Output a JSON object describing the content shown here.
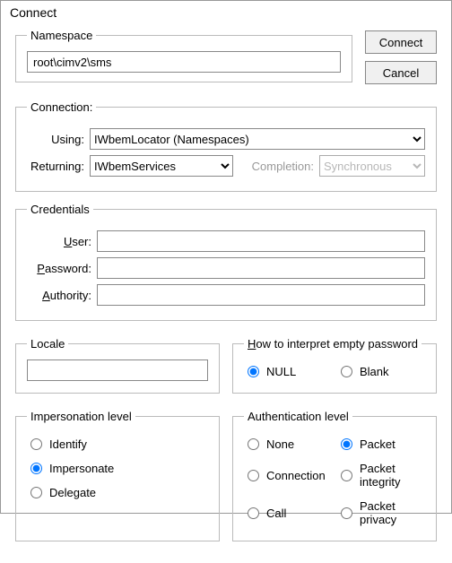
{
  "title": "Connect",
  "buttons": {
    "connect": "Connect",
    "cancel": "Cancel"
  },
  "namespace": {
    "legend": "Namespace",
    "value": "root\\cimv2\\sms"
  },
  "connection": {
    "legend": "Connection:",
    "using_label": "Using:",
    "using_value": "IWbemLocator (Namespaces)",
    "returning_label": "Returning:",
    "returning_value": "IWbemServices",
    "completion_label": "Completion:",
    "completion_value": "Synchronous"
  },
  "credentials": {
    "legend": "Credentials",
    "user_pre": "U",
    "user_rest": "ser:",
    "pass_pre": "P",
    "pass_rest": "assword:",
    "auth_pre": "A",
    "auth_rest": "uthority:",
    "user_value": "",
    "password_value": "",
    "authority_value": ""
  },
  "locale": {
    "legend": "Locale",
    "value": ""
  },
  "empty_pw": {
    "legend_pre": "H",
    "legend_rest": "ow to interpret empty password",
    "null": "NULL",
    "blank": "Blank"
  },
  "impersonation": {
    "legend": "Impersonation level",
    "identify": "Identify",
    "impersonate": "Impersonate",
    "delegate": "Delegate"
  },
  "auth_level": {
    "legend": "Authentication level",
    "none": "None",
    "connection": "Connection",
    "call": "Call",
    "packet": "Packet",
    "integrity": "Packet integrity",
    "privacy": "Packet privacy"
  }
}
